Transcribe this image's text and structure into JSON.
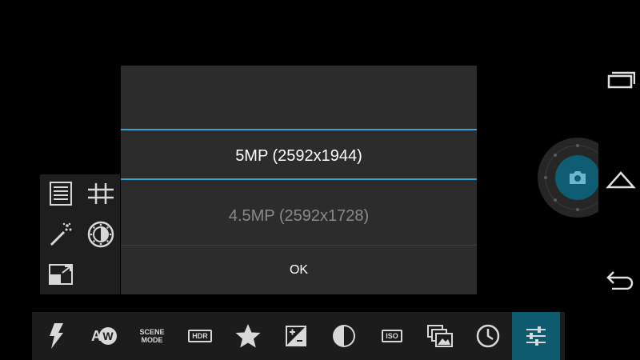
{
  "dialog": {
    "options": [
      {
        "label": "5MP (2592x1944)",
        "selected": true
      },
      {
        "label": "4.5MP (2592x1728)",
        "selected": false
      }
    ],
    "ok_label": "OK"
  },
  "toolbar": {
    "items": [
      {
        "name": "flash-icon"
      },
      {
        "name": "white-balance-icon",
        "text": "W"
      },
      {
        "name": "scene-mode",
        "line1": "SCENE",
        "line2": "MODE"
      },
      {
        "name": "hdr",
        "text": "HDR"
      },
      {
        "name": "star-icon"
      },
      {
        "name": "exposure-icon"
      },
      {
        "name": "contrast-icon"
      },
      {
        "name": "iso",
        "text": "ISO"
      },
      {
        "name": "gallery-icon"
      },
      {
        "name": "timer-icon"
      },
      {
        "name": "settings-sliders-icon",
        "active": true
      }
    ]
  },
  "side_panel": {
    "icons": [
      "document-icon",
      "grid-icon",
      "magic-wand-icon",
      "brightness-icon",
      "resize-icon"
    ]
  },
  "colors": {
    "accent": "#33a4d3",
    "active_tab": "#0e5a6e",
    "shutter": "#0f5d73",
    "dialog_bg": "#2c2c2c"
  }
}
